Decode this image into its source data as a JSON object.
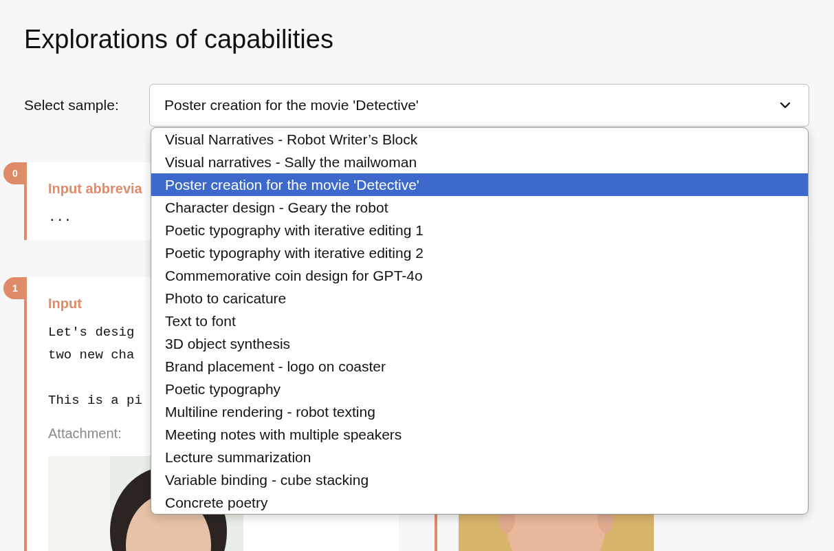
{
  "title": "Explorations of capabilities",
  "select": {
    "label": "Select sample:",
    "value": "Poster creation for the movie 'Detective'",
    "options": [
      {
        "label": "Visual Narratives - Robot Writer’s Block",
        "selected": false
      },
      {
        "label": "Visual narratives - Sally the mailwoman",
        "selected": false
      },
      {
        "label": "Poster creation for the movie 'Detective'",
        "selected": true
      },
      {
        "label": "Character design - Geary the robot",
        "selected": false
      },
      {
        "label": "Poetic typography with iterative editing 1",
        "selected": false
      },
      {
        "label": "Poetic typography with iterative editing 2",
        "selected": false
      },
      {
        "label": "Commemorative coin design for GPT-4o",
        "selected": false
      },
      {
        "label": "Photo to caricature",
        "selected": false
      },
      {
        "label": "Text to font",
        "selected": false
      },
      {
        "label": "3D object synthesis",
        "selected": false
      },
      {
        "label": "Brand placement - logo on coaster",
        "selected": false
      },
      {
        "label": "Poetic typography",
        "selected": false
      },
      {
        "label": "Multiline rendering - robot texting",
        "selected": false
      },
      {
        "label": "Meeting notes with multiple speakers",
        "selected": false
      },
      {
        "label": "Lecture summarization",
        "selected": false
      },
      {
        "label": "Variable binding - cube stacking",
        "selected": false
      },
      {
        "label": "Concrete poetry",
        "selected": false
      }
    ]
  },
  "steps": [
    {
      "badge": "0",
      "heading": "Input abbrevia",
      "paragraphs": [
        [
          "..."
        ]
      ]
    },
    {
      "badge": "1",
      "heading": "Input",
      "paragraphs": [
        [
          "Let's desig",
          "two new cha"
        ],
        [
          "This is a pi"
        ]
      ],
      "attachment_label": "Attachment:"
    }
  ]
}
